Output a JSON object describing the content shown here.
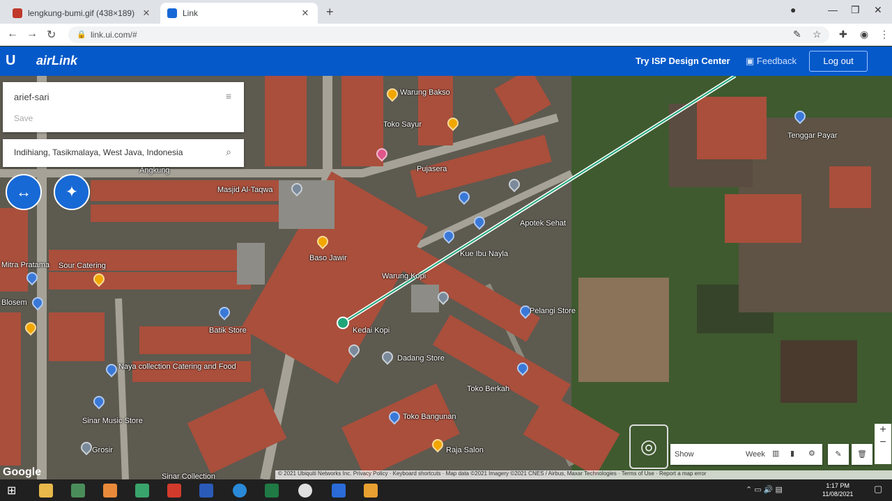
{
  "browser": {
    "tabs": [
      {
        "title": "lengkung-bumi.gif (438×189)",
        "fav_color": "#c0392b"
      },
      {
        "title": "Link",
        "fav_color": "#1769d6"
      }
    ],
    "url": "link.ui.com/#",
    "new_tab_glyph": "+",
    "close_glyph": "✕"
  },
  "app": {
    "u_logo": "U",
    "brand": "airLink",
    "isp_link": "Try ISP Design Center",
    "feedback": "Feedback",
    "logout": "Log out"
  },
  "panel": {
    "name_value": "arief-sari",
    "save_label": "Save",
    "location": "Indihiang, Tasikmalaya, West Java, Indonesia"
  },
  "map": {
    "place_labels": [
      "Angkung",
      "Masjid Al-Taqwa",
      "Sour Catering",
      "Mitra Pratama",
      "Blosem",
      "Baso Jawir",
      "Kue Ibu Nayla",
      "Warung Kopi",
      "Naya collection Catering and Food",
      "Sinar Music Store",
      "Grosir",
      "Batik Store",
      "Pelangi Store",
      "Raja Salon",
      "Sinar Collection",
      "Toko Sayur",
      "Warung Bakso",
      "Pujasera",
      "Apotek Sehat",
      "Kedai Kopi",
      "Dadang Store",
      "Toko Bangunan",
      "Toko Berkah",
      "Tenggar Payar"
    ],
    "google_label": "Google",
    "footer_text": "© 2021 Ubiquiti Networks Inc. Privacy Policy · Keyboard shortcuts · Map data ©2021 Imagery ©2021 CNES / Airbus, Maxar Technologies · Terms of Use · Report a map error",
    "controls": {
      "show_label": "Show",
      "week_label": "Week"
    }
  },
  "taskbar": {
    "time": "1:17 PM",
    "date": "11/08/2021"
  }
}
